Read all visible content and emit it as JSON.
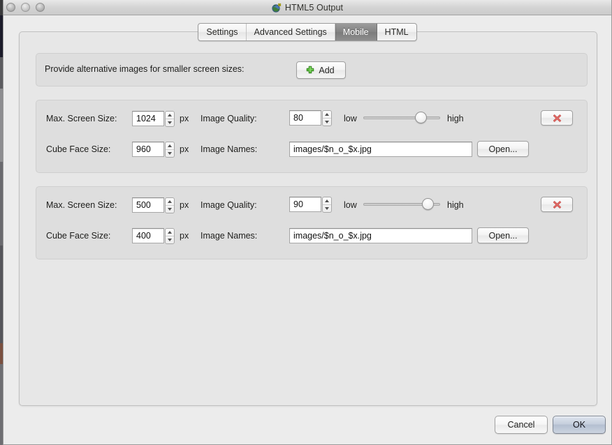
{
  "window": {
    "title": "HTML5 Output",
    "title_icon": "globe-icon",
    "traffic_lights": [
      "close",
      "minimize",
      "zoom"
    ]
  },
  "tabs": [
    {
      "label": "Settings",
      "selected": false
    },
    {
      "label": "Advanced Settings",
      "selected": false
    },
    {
      "label": "Mobile",
      "selected": true
    },
    {
      "label": "HTML",
      "selected": false
    }
  ],
  "header_panel": {
    "label": "Provide alternative images for smaller screen sizes:",
    "add_button": {
      "label": "Add",
      "icon": "plus-icon"
    }
  },
  "groups": [
    {
      "max_screen_size": {
        "label": "Max. Screen Size:",
        "value": "1024",
        "unit": "px"
      },
      "image_quality": {
        "label": "Image Quality:",
        "value": "80"
      },
      "quality_slider": {
        "low_label": "low",
        "high_label": "high",
        "value": 80,
        "min": 0,
        "max": 100
      },
      "cube_face_size": {
        "label": "Cube Face Size:",
        "value": "960",
        "unit": "px"
      },
      "image_names": {
        "label": "Image Names:",
        "value": "images/$n_o_$x.jpg"
      },
      "open_button": {
        "label": "Open..."
      },
      "delete_button": {
        "icon": "red-x-icon"
      }
    },
    {
      "max_screen_size": {
        "label": "Max. Screen Size:",
        "value": "500",
        "unit": "px"
      },
      "image_quality": {
        "label": "Image Quality:",
        "value": "90"
      },
      "quality_slider": {
        "low_label": "low",
        "high_label": "high",
        "value": 90,
        "min": 0,
        "max": 100
      },
      "cube_face_size": {
        "label": "Cube Face Size:",
        "value": "400",
        "unit": "px"
      },
      "image_names": {
        "label": "Image Names:",
        "value": "images/$n_o_$x.jpg"
      },
      "open_button": {
        "label": "Open..."
      },
      "delete_button": {
        "icon": "red-x-icon"
      }
    }
  ],
  "footer": {
    "cancel_label": "Cancel",
    "ok_label": "OK"
  },
  "colors": {
    "accent_green": "#5cbf3c",
    "delete_red": "#e06a66",
    "selected_tab_bg": "#828282",
    "default_button_blue": "#c6cfdd"
  }
}
